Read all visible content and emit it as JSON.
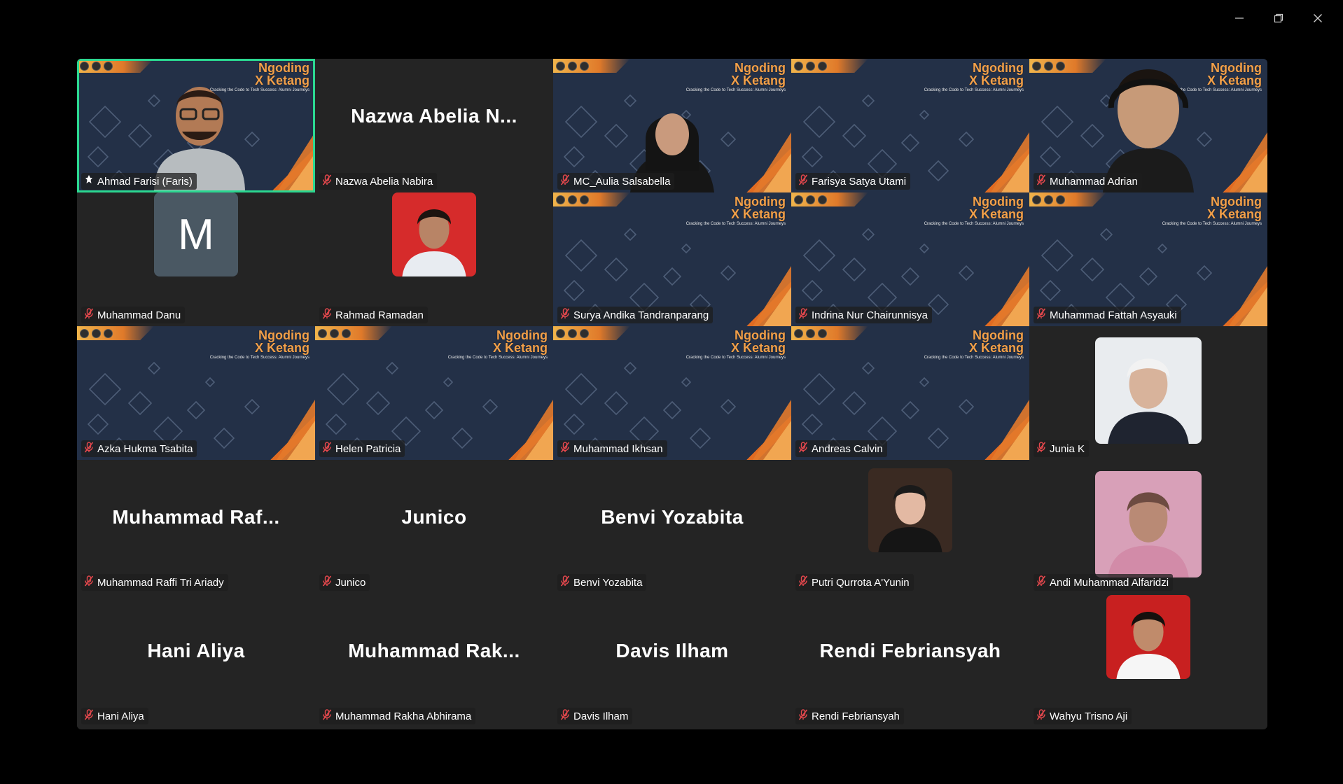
{
  "window": {
    "controls": [
      "minimize-icon",
      "restore-icon",
      "close-icon"
    ]
  },
  "brand": {
    "line1": "Ngoding",
    "line2": "X Ketang",
    "tagline": "Cracking the Code to Tech Success: Alumni Journeys"
  },
  "colors": {
    "active_border": "#2bd891",
    "muted_mic": "#e5484d",
    "tile_bg": "#242424",
    "virtual_bg": "#233047",
    "accent_orange": "#e06b22"
  },
  "participants": [
    {
      "display_name": "Ahmad Farisi (Faris)",
      "big_name": "",
      "kind": "video",
      "muted": false,
      "pinned": true,
      "active": true
    },
    {
      "display_name": "Nazwa Abelia Nabira",
      "big_name": "Nazwa  Abelia  N...",
      "kind": "name",
      "muted": true
    },
    {
      "display_name": "MC_Aulia Salsabella",
      "big_name": "",
      "kind": "video",
      "muted": true
    },
    {
      "display_name": "Farisya Satya Utami",
      "big_name": "",
      "kind": "background",
      "muted": true
    },
    {
      "display_name": "Muhammad Adrian",
      "big_name": "",
      "kind": "video",
      "muted": true
    },
    {
      "display_name": "Muhammad Danu",
      "big_name": "",
      "kind": "letter",
      "letter": "M",
      "muted": true
    },
    {
      "display_name": "Rahmad Ramadan",
      "big_name": "",
      "kind": "photo",
      "muted": true
    },
    {
      "display_name": "Surya Andika Tandranparang",
      "big_name": "",
      "kind": "background",
      "muted": true
    },
    {
      "display_name": "Indrina Nur Chairunnisya",
      "big_name": "",
      "kind": "background",
      "muted": true
    },
    {
      "display_name": "Muhammad Fattah Asyauki",
      "big_name": "",
      "kind": "background",
      "muted": true
    },
    {
      "display_name": "Azka Hukma Tsabita",
      "big_name": "",
      "kind": "background",
      "muted": true
    },
    {
      "display_name": "Helen Patricia",
      "big_name": "",
      "kind": "background",
      "muted": true
    },
    {
      "display_name": "Muhammad Ikhsan",
      "big_name": "",
      "kind": "background",
      "muted": true
    },
    {
      "display_name": "Andreas Calvin",
      "big_name": "",
      "kind": "background",
      "muted": true
    },
    {
      "display_name": "Junia K",
      "big_name": "",
      "kind": "photo",
      "muted": true
    },
    {
      "display_name": "Muhammad Raffi Tri Ariady",
      "big_name": "Muhammad  Raf...",
      "kind": "name",
      "muted": true
    },
    {
      "display_name": "Junico",
      "big_name": "Junico",
      "kind": "name",
      "muted": true
    },
    {
      "display_name": "Benvi Yozabita",
      "big_name": "Benvi Yozabita",
      "kind": "name",
      "muted": true
    },
    {
      "display_name": "Putri Qurrota A'Yunin",
      "big_name": "",
      "kind": "photo",
      "muted": true
    },
    {
      "display_name": "Andi Muhammad Alfaridzi",
      "big_name": "",
      "kind": "photo",
      "muted": true
    },
    {
      "display_name": "Hani Aliya",
      "big_name": "Hani Aliya",
      "kind": "name",
      "muted": true
    },
    {
      "display_name": "Muhammad Rakha Abhirama",
      "big_name": "Muhammad  Rak...",
      "kind": "name",
      "muted": true
    },
    {
      "display_name": "Davis Ilham",
      "big_name": "Davis Ilham",
      "kind": "name",
      "muted": true
    },
    {
      "display_name": "Rendi Febriansyah",
      "big_name": "Rendi Febriansyah",
      "kind": "name",
      "muted": true
    },
    {
      "display_name": "Wahyu Trisno Aji",
      "big_name": "",
      "kind": "photo",
      "muted": true
    }
  ]
}
